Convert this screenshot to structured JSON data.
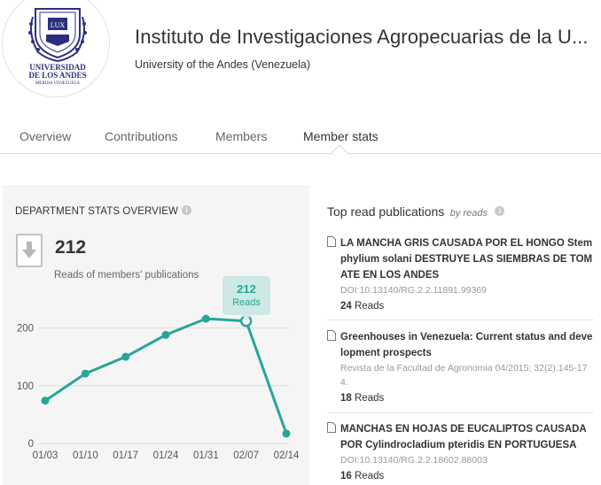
{
  "header": {
    "title": "Instituto de Investigaciones Agropecuarias de la U...",
    "subtitle": "University of the Andes (Venezuela)",
    "logo_text": [
      "UNIVERSIDAD",
      "DE LOS ANDES",
      "MERIDA VENEZUELA"
    ]
  },
  "tabs": [
    {
      "label": "Overview"
    },
    {
      "label": "Contributions"
    },
    {
      "label": "Members"
    },
    {
      "label": "Member stats",
      "active": true
    }
  ],
  "stats": {
    "title": "DEPARTMENT STATS OVERVIEW",
    "info_icon": "info-icon",
    "download_icon": "download-icon",
    "total": "212",
    "label": "Reads of members' publications",
    "tooltip": {
      "value": "212",
      "label": "Reads"
    }
  },
  "chart_data": {
    "type": "line",
    "categories": [
      "01/03",
      "01/10",
      "01/17",
      "01/24",
      "01/31",
      "02/07",
      "02/14"
    ],
    "series": [
      {
        "values": [
          74,
          121,
          150,
          188,
          216,
          212,
          17
        ]
      }
    ],
    "ylim": [
      0,
      230
    ],
    "yticks": [
      "0",
      "100",
      "200"
    ],
    "highlight_index": 5,
    "grid": true,
    "color": "#26a69a"
  },
  "publications": {
    "heading": "Top read publications",
    "by": "by reads",
    "items": [
      {
        "title": "LA MANCHA GRIS CAUSADA POR EL HONGO Stemphylium solani DESTRUYE LAS SIEMBRAS DE TOMATE EN LOS ANDES",
        "meta": "DOI:10.13140/RG.2.2.11891.99369",
        "reads": "24",
        "reads_label": "Reads"
      },
      {
        "title": "Greenhouses in Venezuela: Current status and development prospects",
        "meta": "Revista de la Facultad de Agronomia 04/2015; 32(2):145-174.",
        "reads": "18",
        "reads_label": "Reads"
      },
      {
        "title": "MANCHAS EN HOJAS DE EUCALIPTOS CAUSADA POR Cylindrocladium pteridis EN PORTUGUESA",
        "meta": "DOI:10.13140/RG.2.2.18602.88003",
        "reads": "16",
        "reads_label": "Reads"
      }
    ]
  }
}
